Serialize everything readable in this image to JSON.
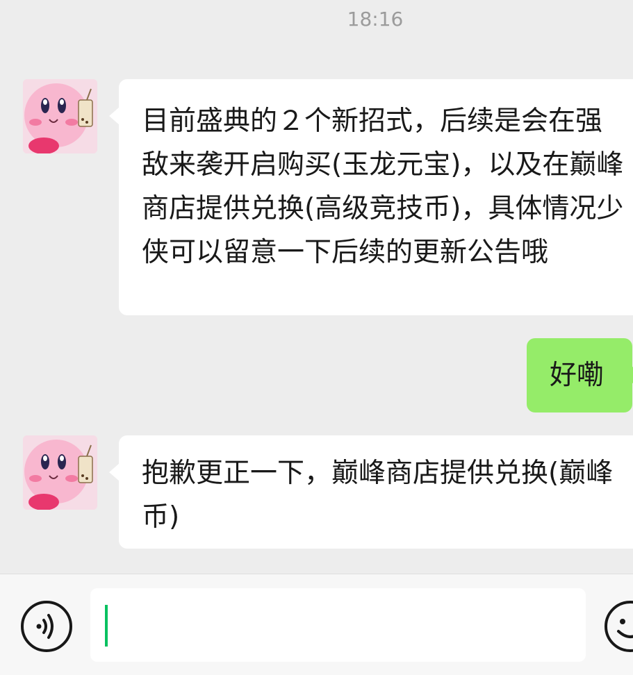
{
  "header": {
    "timestamp": "18:16"
  },
  "messages": [
    {
      "sender": "contact",
      "avatar_icon": "kirby-avatar-icon",
      "text": "目前盛典的２个新招式，后续是会在强敌来袭开启购买(玉龙元宝)，以及在巅峰商店提供兑换(高级竞技币)，具体情况少侠可以留意一下后续的更新公告哦"
    },
    {
      "sender": "self",
      "text": "好嘞"
    },
    {
      "sender": "contact",
      "avatar_icon": "kirby-avatar-icon",
      "text": "抱歉更正一下，巅峰商店提供兑换(巅峰币)"
    }
  ],
  "input_bar": {
    "voice_icon": "voice-icon",
    "input_value": "",
    "emoji_icon": "emoji-icon"
  },
  "colors": {
    "background": "#ededed",
    "incoming_bubble": "#ffffff",
    "outgoing_bubble": "#95ec69",
    "caret": "#07c160"
  }
}
